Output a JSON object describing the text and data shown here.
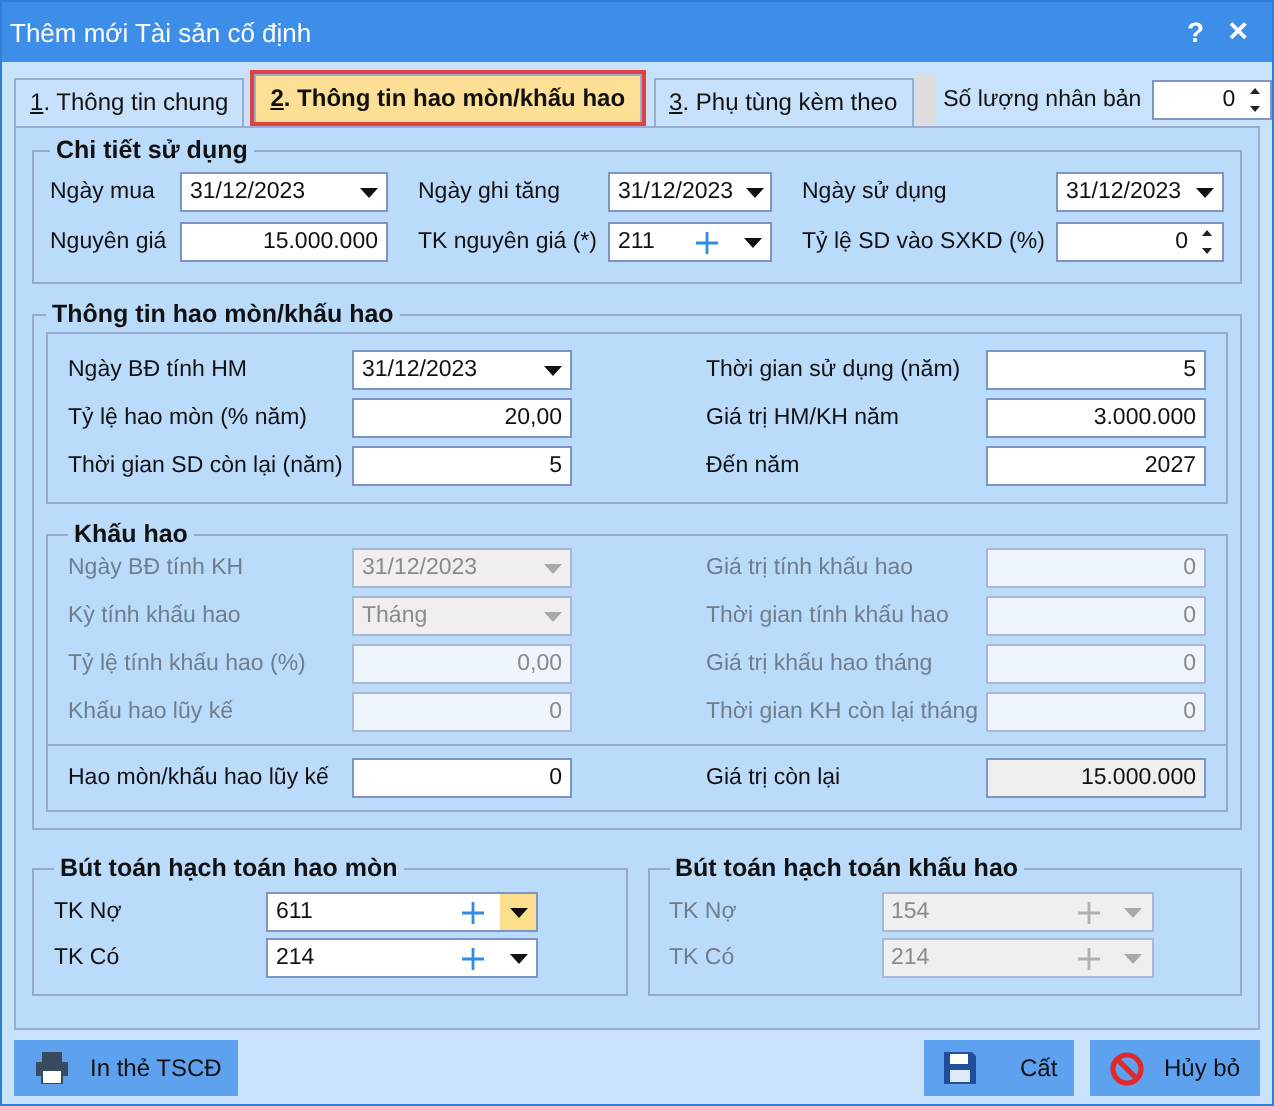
{
  "window": {
    "title": "Thêm mới Tài sản cố định",
    "help": "?",
    "close": "×"
  },
  "tabs": [
    {
      "number": "1",
      "label": ". Thông tin chung",
      "selected": false
    },
    {
      "number": "2",
      "label": ". Thông tin hao mòn/khấu hao",
      "selected": true
    },
    {
      "number": "3",
      "label": ". Phụ tùng kèm theo",
      "selected": false
    }
  ],
  "copies": {
    "label": "Số lượng nhân bản",
    "value": "0",
    "kind": "spin"
  },
  "usage": {
    "title": "Chi tiết sử dụng",
    "fields": [
      {
        "label": "Ngày mua",
        "value": "31/12/2023",
        "kind": "date"
      },
      {
        "label": "Ngày ghi tăng",
        "value": "31/12/2023",
        "kind": "date"
      },
      {
        "label": "Ngày sử dụng",
        "value": "31/12/2023",
        "kind": "date"
      },
      {
        "label": "Nguyên giá",
        "value": "15.000.000",
        "kind": "number"
      },
      {
        "label": "TK nguyên giá (*)",
        "value": "211",
        "kind": "account"
      },
      {
        "label": "Tỷ lệ SD vào SXKD (%)",
        "value": "0",
        "kind": "spin"
      }
    ]
  },
  "depreciation": {
    "title": "Thông tin hao mòn/khấu hao",
    "wear": {
      "left": [
        {
          "label": "Ngày BĐ tính HM",
          "value": "31/12/2023",
          "kind": "date"
        },
        {
          "label": "Tỷ lệ hao mòn (% năm)",
          "value": "20,00",
          "kind": "number"
        },
        {
          "label": "Thời gian SD còn lại (năm)",
          "value": "5",
          "kind": "number"
        }
      ],
      "right": [
        {
          "label": "Thời gian sử dụng (năm)",
          "value": "5",
          "kind": "number"
        },
        {
          "label": "Giá trị HM/KH năm",
          "value": "3.000.000",
          "kind": "number"
        },
        {
          "label": "Đến năm",
          "value": "2027",
          "kind": "number"
        }
      ]
    },
    "amortization": {
      "title": "Khấu hao",
      "disabled": true,
      "left": [
        {
          "label": "Ngày BĐ tính KH",
          "value": "31/12/2023",
          "kind": "date"
        },
        {
          "label": "Kỳ tính khấu hao",
          "value": "Tháng",
          "kind": "select"
        },
        {
          "label": "Tỷ lệ tính khấu hao (%)",
          "value": "0,00",
          "kind": "number"
        },
        {
          "label": "Khấu hao lũy kế",
          "value": "0",
          "kind": "number"
        }
      ],
      "right": [
        {
          "label": "Giá trị tính khấu hao",
          "value": "0",
          "kind": "number"
        },
        {
          "label": "Thời gian tính khấu hao",
          "value": "0",
          "kind": "number"
        },
        {
          "label": "Giá trị khấu hao tháng",
          "value": "0",
          "kind": "number"
        },
        {
          "label": "Thời gian KH còn lại tháng",
          "value": "0",
          "kind": "number"
        }
      ]
    },
    "totals": [
      {
        "label": "Hao mòn/khấu hao lũy kế",
        "value": "0",
        "kind": "number",
        "readonly": false
      },
      {
        "label": "Giá trị còn lại",
        "value": "15.000.000",
        "kind": "number",
        "readonly": true
      }
    ]
  },
  "entries": [
    {
      "title": "Bút toán hạch toán hao mòn",
      "disabled": false,
      "rows": [
        {
          "label": "TK Nợ",
          "value": "611",
          "kind": "account",
          "focused": true
        },
        {
          "label": "TK Có",
          "value": "214",
          "kind": "account",
          "focused": false
        }
      ]
    },
    {
      "title": "Bút toán hạch toán khấu hao",
      "disabled": true,
      "rows": [
        {
          "label": "TK Nợ",
          "value": "154",
          "kind": "account",
          "focused": false
        },
        {
          "label": "TK Có",
          "value": "214",
          "kind": "account",
          "focused": false
        }
      ]
    }
  ],
  "buttons": [
    {
      "label": "In thẻ TSCĐ",
      "kind": "print"
    },
    {
      "label": "Cất",
      "kind": "save"
    },
    {
      "label": "Hủy bỏ",
      "kind": "cancel"
    }
  ]
}
